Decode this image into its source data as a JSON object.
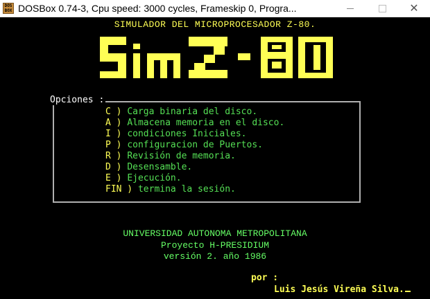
{
  "window": {
    "icon_text": "DOS BOX",
    "title": "DOSBox 0.74-3, Cpu speed:     3000 cycles, Frameskip  0, Progra..."
  },
  "header": {
    "subtitle": "SIMULADOR DEL MICROPROCESADOR Z-80.",
    "logo_text": "Sim Z-80"
  },
  "menu": {
    "label": "Opciones :",
    "items": [
      {
        "key": "C",
        "desc": "Carga binaria del disco."
      },
      {
        "key": "A",
        "desc": "Almacena memoria en el disco."
      },
      {
        "key": "I",
        "desc": "condiciones Iniciales."
      },
      {
        "key": "P",
        "desc": "configuracion de Puertos."
      },
      {
        "key": "R",
        "desc": "Revisión de memoria."
      },
      {
        "key": "D",
        "desc": "Desensamble."
      },
      {
        "key": "E",
        "desc": "Ejecución."
      },
      {
        "key": "FIN",
        "desc": "termina la sesión."
      }
    ]
  },
  "credits": {
    "university": "UNIVERSIDAD AUTONOMA METROPOLITANA",
    "project": "Proyecto H-PRESIDIUM",
    "version": "versión 2. año 1986",
    "by_label": "por :",
    "author": "Luis Jesús Vireña Silva."
  },
  "colors": {
    "background": "#000000",
    "yellow": "#ffff55",
    "green": "#55e055",
    "border": "#b0b0b0"
  }
}
